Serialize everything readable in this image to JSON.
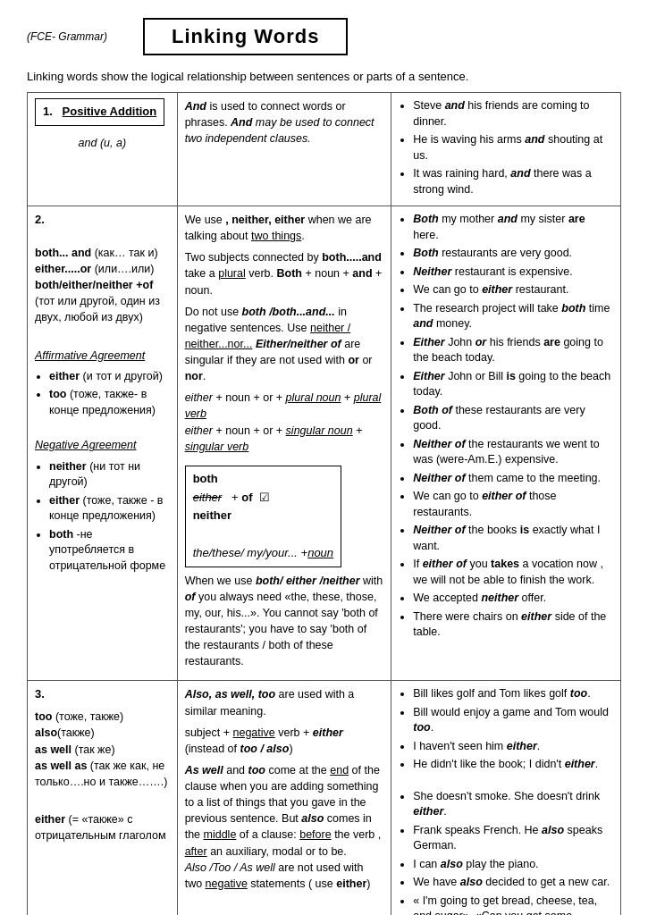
{
  "header": {
    "fce_label": "(FCE- Grammar)",
    "title": "Linking Words"
  },
  "intro": "Linking words show the logical relationship between sentences or parts of a sentence.",
  "rows": [
    {
      "id": "row1",
      "left_num": "1.",
      "left_heading": "Positive Addition",
      "left_sub": "and (и, а)",
      "mid_text": "And is used to connect words or phrases. And may be used to connect two independent clauses.",
      "right_bullets": [
        "Steve and his friends are coming to dinner.",
        "He is waving his arms and shouting at us.",
        "It was raining hard, and there was a strong wind."
      ]
    },
    {
      "id": "row2",
      "left_num": "2.",
      "right_bullets": [
        "Both my mother and my sister are here.",
        "Both restaurants are very good.",
        "Neither restaurant is expensive.",
        "We can go to either restaurant.",
        "The research project will take both time and money.",
        "Either John or his friends are going to the beach today.",
        "Either John or Bill is going to the beach today.",
        "Both of these restaurants are very good.",
        "Neither of the restaurants we went to was (were-Am.E.) expensive.",
        "Neither of them came to the meeting.",
        "We can go to either of those restaurants.",
        "Neither of the books is exactly what I want.",
        "If either of you takes a vocation now , we will not be able to finish the work.",
        "We accepted neither offer.",
        "There were chairs on either side of the table."
      ]
    },
    {
      "id": "row3",
      "left_num": "3.",
      "right_bullets_top": [
        "Bill likes golf and Tom likes golf too.",
        "Bill would enjoy a game and Tom would too.",
        "I haven't seen him either.",
        "He didn't like the book; I didn't either."
      ],
      "right_bullets_bottom": [
        "She doesn't smoke. She doesn't drink either.",
        "Frank speaks French. He also speaks German.",
        "I can also play the piano.",
        "We have also decided to get a new car.",
        "« I'm going to get bread, cheese, tea, and sugar». «Can you get some"
      ]
    }
  ]
}
